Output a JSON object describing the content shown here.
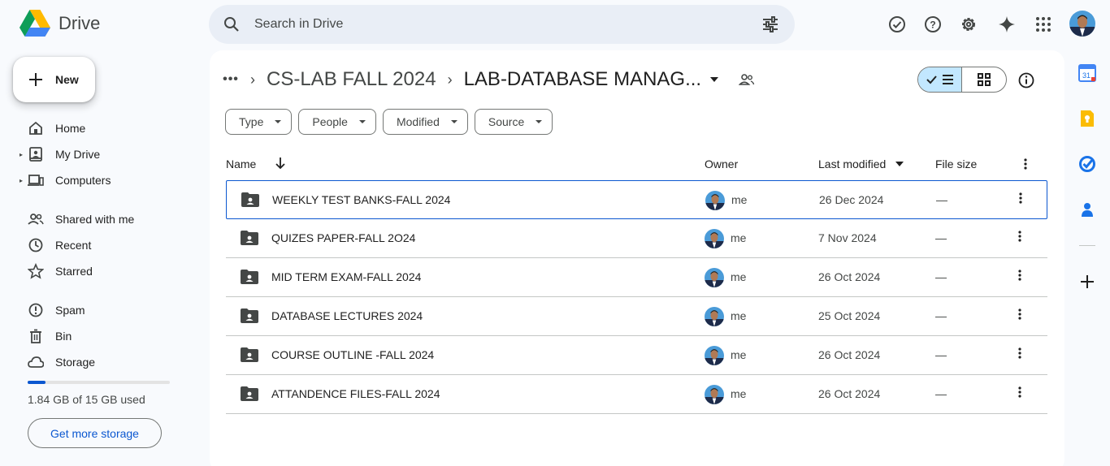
{
  "app": {
    "name": "Drive"
  },
  "search": {
    "placeholder": "Search in Drive"
  },
  "sidebar": {
    "new_label": "New",
    "items": [
      {
        "label": "Home",
        "icon": "home-icon"
      },
      {
        "label": "My Drive",
        "icon": "my-drive-icon"
      },
      {
        "label": "Computers",
        "icon": "computers-icon"
      },
      {
        "label": "Shared with me",
        "icon": "shared-icon"
      },
      {
        "label": "Recent",
        "icon": "clock-icon"
      },
      {
        "label": "Starred",
        "icon": "star-icon"
      },
      {
        "label": "Spam",
        "icon": "spam-icon"
      },
      {
        "label": "Bin",
        "icon": "trash-icon"
      },
      {
        "label": "Storage",
        "icon": "cloud-icon"
      }
    ],
    "storage": {
      "used_text": "1.84 GB of 15 GB used",
      "used_fraction": 0.123,
      "button": "Get more storage"
    }
  },
  "breadcrumb": {
    "parent": "CS-LAB FALL 2024",
    "current": "LAB-DATABASE MANAG..."
  },
  "filters": [
    "Type",
    "People",
    "Modified",
    "Source"
  ],
  "table": {
    "headers": {
      "name": "Name",
      "owner": "Owner",
      "modified": "Last modified",
      "size": "File size"
    },
    "rows": [
      {
        "name": "WEEKLY TEST BANKS-FALL 2024",
        "owner": "me",
        "modified": "26 Dec 2024",
        "size": "—"
      },
      {
        "name": "QUIZES PAPER-FALL 2O24",
        "owner": "me",
        "modified": "7 Nov 2024",
        "size": "—"
      },
      {
        "name": "MID TERM EXAM-FALL 2024",
        "owner": "me",
        "modified": "26 Oct 2024",
        "size": "—"
      },
      {
        "name": "DATABASE LECTURES 2024",
        "owner": "me",
        "modified": "25 Oct 2024",
        "size": "—"
      },
      {
        "name": "COURSE OUTLINE -FALL 2024",
        "owner": "me",
        "modified": "26 Oct 2024",
        "size": "—"
      },
      {
        "name": "ATTANDENCE FILES-FALL 2024",
        "owner": "me",
        "modified": "26 Oct 2024",
        "size": "—"
      }
    ]
  },
  "colors": {
    "accent": "#0b57d0",
    "selected": "#c2e7ff",
    "background": "#f8fafd"
  }
}
